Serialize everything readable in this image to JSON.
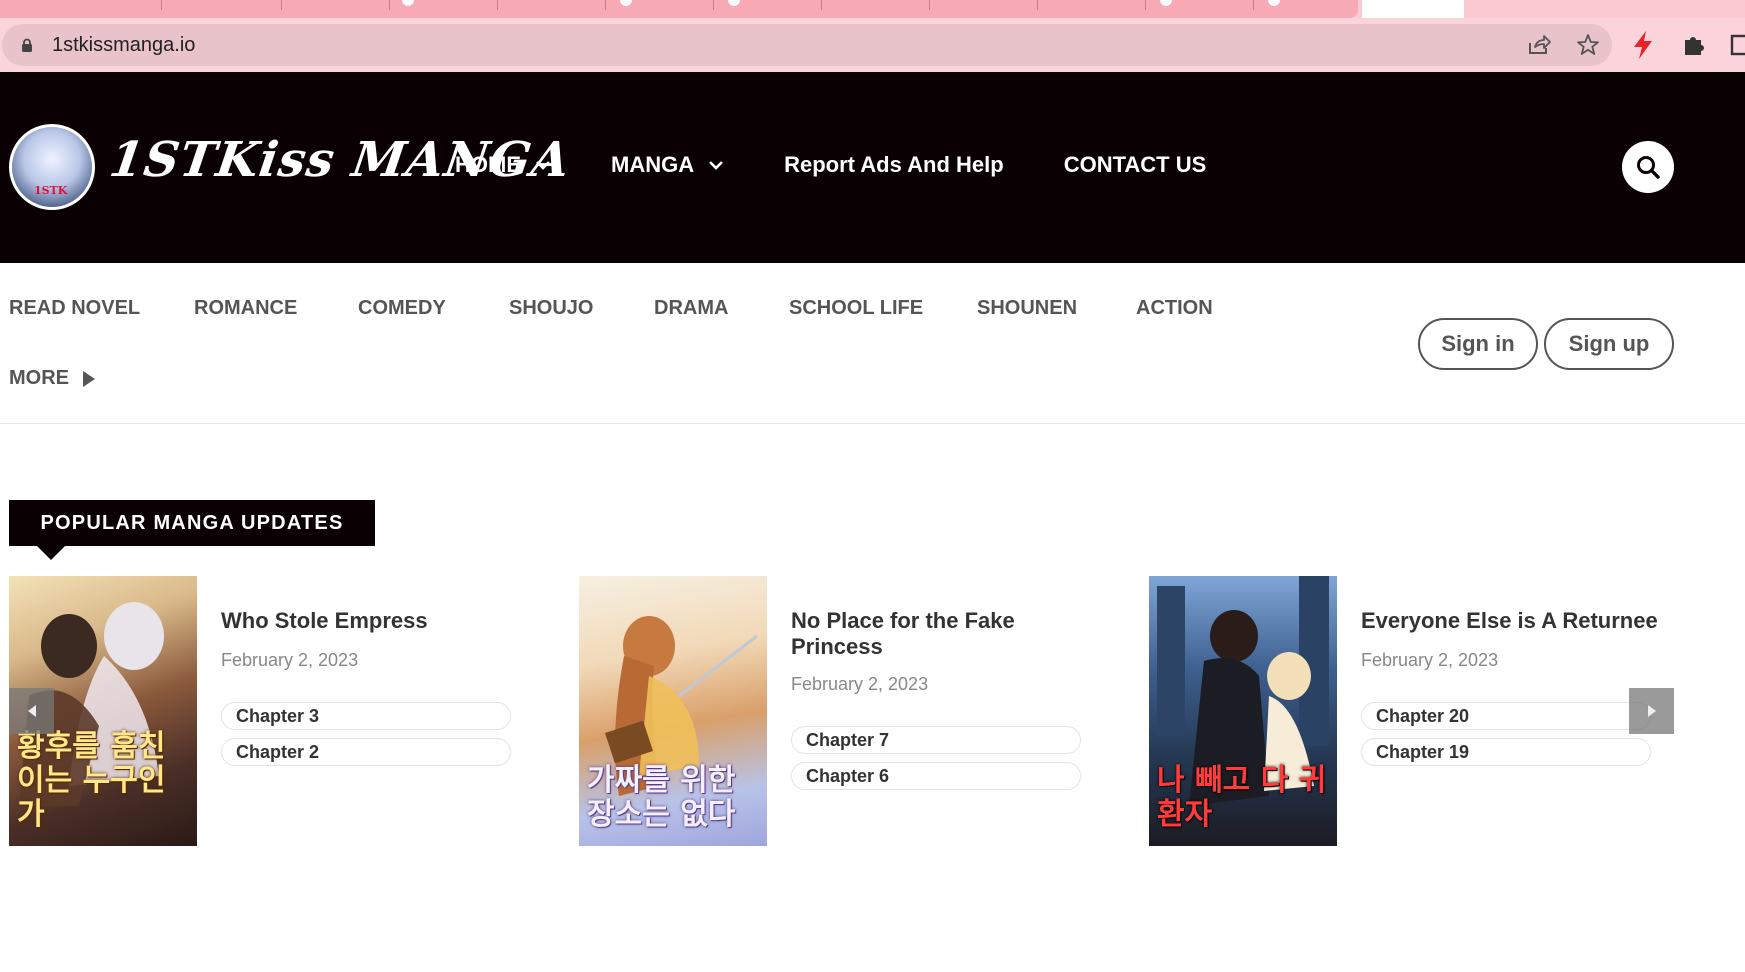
{
  "browser": {
    "url": "1stkissmanga.io",
    "icons": [
      "lock-icon",
      "share-icon",
      "star-icon",
      "bolt-icon",
      "puzzle-icon",
      "side-panel-icon"
    ]
  },
  "header": {
    "logo_text": "1STKiss MANGA",
    "logo_badge": "1STK",
    "nav": [
      {
        "label": "HOME",
        "has_dropdown": true
      },
      {
        "label": "MANGA",
        "has_dropdown": true
      },
      {
        "label": "Report Ads And Help",
        "has_dropdown": false
      },
      {
        "label": "CONTACT US",
        "has_dropdown": false
      }
    ],
    "search_icon": "search-icon"
  },
  "genres": [
    "READ NOVEL",
    "ROMANCE",
    "COMEDY",
    "SHOUJO",
    "DRAMA",
    "SCHOOL LIFE",
    "SHOUNEN",
    "ACTION"
  ],
  "more_label": "MORE",
  "auth": {
    "sign_in": "Sign in",
    "sign_up": "Sign up"
  },
  "popular": {
    "title": "POPULAR MANGA UPDATES",
    "items": [
      {
        "title": "Who Stole Empress",
        "date": "February 2, 2023",
        "cover_text": "황후를 훔친 이는 누구인가",
        "chapters": [
          "Chapter 3",
          "Chapter 2"
        ]
      },
      {
        "title": "No Place for the Fake Princess",
        "date": "February 2, 2023",
        "cover_text": "가짜를 위한 장소는 없다",
        "chapters": [
          "Chapter 7",
          "Chapter 6"
        ]
      },
      {
        "title": "Everyone Else is A Returnee",
        "date": "February 2, 2023",
        "cover_text": "나 빼고 다 귀환자",
        "chapters": [
          "Chapter 20",
          "Chapter 19"
        ]
      }
    ]
  },
  "colors": {
    "header_bg": "#0a0003",
    "chrome_pink": "#fbd3da",
    "tab_pink": "#f7a9b6",
    "text_gray": "#555555"
  }
}
